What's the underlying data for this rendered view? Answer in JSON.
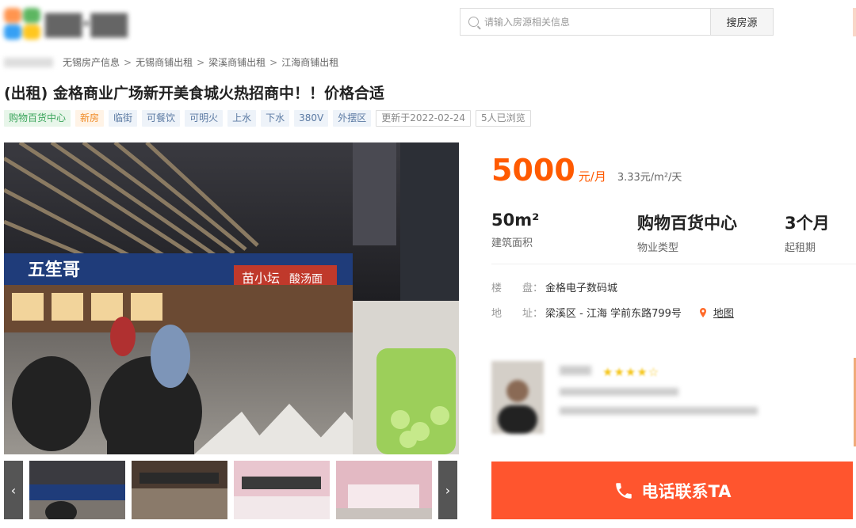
{
  "search": {
    "placeholder": "请输入房源相关信息",
    "button": "搜房源"
  },
  "breadcrumb": [
    "无锡房产信息",
    "无锡商铺出租",
    "梁溪商铺出租",
    "江海商铺出租"
  ],
  "title": "(出租) 金格商业广场新开美食城火热招商中！！价格合适",
  "tags": [
    {
      "text": "购物百货中心",
      "style": "green"
    },
    {
      "text": "新房",
      "style": "orange"
    },
    {
      "text": "临街",
      "style": "blue"
    },
    {
      "text": "可餐饮",
      "style": "blue"
    },
    {
      "text": "可明火",
      "style": "blue"
    },
    {
      "text": "上水",
      "style": "blue"
    },
    {
      "text": "下水",
      "style": "blue"
    },
    {
      "text": "380V",
      "style": "blue"
    },
    {
      "text": "外摆区",
      "style": "blue"
    },
    {
      "text": "更新于2022-02-24",
      "style": "gray"
    },
    {
      "text": "5人已浏览",
      "style": "gray"
    }
  ],
  "price": {
    "value": "5000",
    "unit": "元/月",
    "per_day": "3.33元/m²/天"
  },
  "stats": [
    {
      "value": "50m²",
      "label": "建筑面积"
    },
    {
      "value": "购物百货中心",
      "label": "物业类型"
    },
    {
      "value": "3个月",
      "label": "起租期"
    }
  ],
  "info": {
    "building_label": "楼　　盘：",
    "building": "金格电子数码城",
    "address_label": "地　　址：",
    "address": "梁溪区 - 江海 学前东路799号",
    "map_link": "地图"
  },
  "gallery": {
    "prev": "‹",
    "next": "›"
  },
  "photo_signs": {
    "sign1": "五笙哥",
    "sign2": "苗小坛",
    "sign3": "酸汤面"
  },
  "call_button": "电话联系TA",
  "colors": {
    "accent": "#ff5a00",
    "call": "#ff552e"
  }
}
